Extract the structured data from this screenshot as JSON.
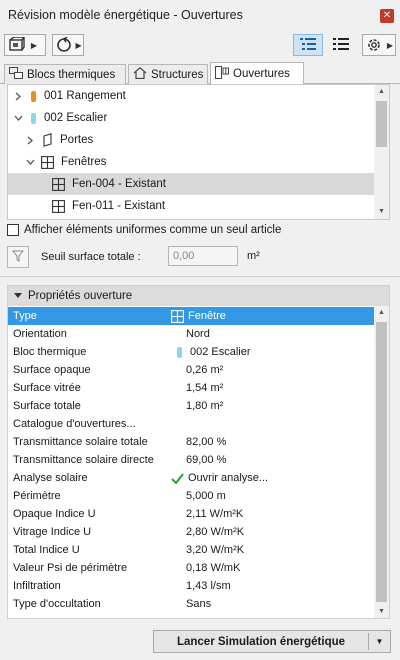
{
  "window": {
    "title": "Révision modèle énergétique - Ouvertures",
    "close_glyph": "✕"
  },
  "toolbar": {
    "model_icon": "model-3d-icon",
    "refresh_icon": "refresh-icon",
    "list_view_icon": "list-view-icon",
    "detail_view_icon": "detail-list-icon",
    "settings_icon": "gear-icon"
  },
  "tabs": [
    {
      "label": "Blocs thermiques",
      "icon": "thermal-blocks-icon"
    },
    {
      "label": "Structures",
      "icon": "house-icon"
    },
    {
      "label": "Ouvertures",
      "icon": "window-door-icon"
    }
  ],
  "tree": {
    "rows": [
      {
        "label": "001 Rangement",
        "color": "#e8901e",
        "level": 0,
        "expanded": false
      },
      {
        "label": "002 Escalier",
        "color": "#8ed8e6",
        "level": 0,
        "expanded": true
      },
      {
        "label": "Portes",
        "icon": "door-icon",
        "level": 1,
        "expanded": false
      },
      {
        "label": "Fenêtres",
        "icon": "window-icon",
        "level": 1,
        "expanded": true
      },
      {
        "label": "Fen-004 - Existant",
        "icon": "window-icon",
        "level": 2,
        "selected": true
      },
      {
        "label": "Fen-011 - Existant",
        "icon": "window-icon",
        "level": 2
      }
    ]
  },
  "uniform_checkbox": {
    "label": "Afficher éléments uniformes comme un seul article",
    "checked": false
  },
  "threshold": {
    "label": "Seuil surface totale :",
    "value": "0,00",
    "unit": "m²"
  },
  "properties": {
    "header": "Propriétés ouverture",
    "rows": [
      {
        "label": "Type",
        "value": "Fenêtre",
        "icon": "window-icon",
        "selected": true
      },
      {
        "label": "Orientation",
        "value": "Nord"
      },
      {
        "label": "Bloc thermique",
        "value": "002 Escalier",
        "swatch": "#8ed8e6"
      },
      {
        "label": "Surface opaque",
        "value": "0,26 m²"
      },
      {
        "label": "Surface vitrée",
        "value": "1,54 m²"
      },
      {
        "label": "Surface totale",
        "value": "1,80 m²"
      },
      {
        "label": "Catalogue d'ouvertures...",
        "value": ""
      },
      {
        "label": "Transmittance solaire totale",
        "value": "82,00 %"
      },
      {
        "label": "Transmittance solaire directe",
        "value": "69,00 %"
      },
      {
        "label": "Analyse solaire",
        "value": "Ouvrir analyse...",
        "icon": "checkmark-icon"
      },
      {
        "label": "Périmètre",
        "value": "5,000 m"
      },
      {
        "label": "Opaque Indice U",
        "value": "2,11 W/m²K"
      },
      {
        "label": "Vitrage Indice U",
        "value": "2,80 W/m²K"
      },
      {
        "label": "Total Indice U",
        "value": "3,20 W/m²K"
      },
      {
        "label": "Valeur Psi de périmètre",
        "value": "0,18 W/mK"
      },
      {
        "label": "Infiltration",
        "value": "1,43 l/sm"
      },
      {
        "label": "Type d'occultation",
        "value": "Sans"
      }
    ]
  },
  "simulate_button": {
    "label": "Lancer Simulation énergétique"
  },
  "colors": {
    "selection": "#3399e6",
    "accent_check": "#2e9e3e"
  }
}
